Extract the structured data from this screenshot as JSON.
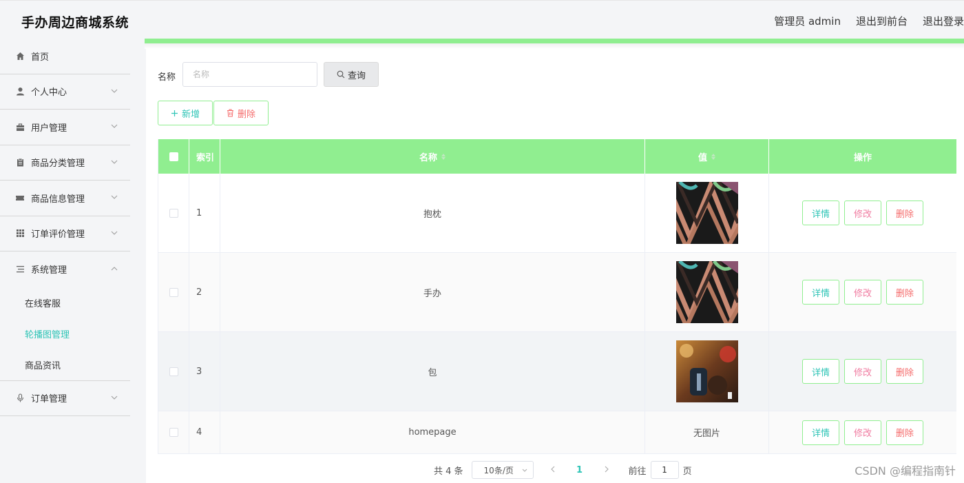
{
  "app": {
    "title": "手办周边商城系统"
  },
  "header": {
    "admin_label": "管理员 admin",
    "to_front": "退出到前台",
    "logout": "退出登录"
  },
  "sidebar": {
    "items": [
      {
        "label": "首页",
        "icon": "home-icon"
      },
      {
        "label": "个人中心",
        "icon": "user-icon"
      },
      {
        "label": "用户管理",
        "icon": "briefcase-icon"
      },
      {
        "label": "商品分类管理",
        "icon": "clipboard-icon"
      },
      {
        "label": "商品信息管理",
        "icon": "ticket-icon"
      },
      {
        "label": "订单评价管理",
        "icon": "grid-icon"
      },
      {
        "label": "系统管理",
        "icon": "list-icon"
      },
      {
        "label": "订单管理",
        "icon": "microphone-icon"
      }
    ],
    "system_sub": [
      {
        "label": "在线客服",
        "active": false
      },
      {
        "label": "轮播图管理",
        "active": true
      },
      {
        "label": "商品资讯",
        "active": false
      }
    ]
  },
  "search": {
    "label": "名称",
    "placeholder": "名称",
    "button": "查询"
  },
  "actions": {
    "add": "新增",
    "delete": "删除"
  },
  "table": {
    "columns": [
      "索引",
      "名称",
      "值",
      "操作"
    ],
    "rows": [
      {
        "index": "1",
        "name": "抱枕",
        "value": "",
        "image": "pattern"
      },
      {
        "index": "2",
        "name": "手办",
        "value": "",
        "image": "pattern"
      },
      {
        "index": "3",
        "name": "包",
        "value": "",
        "image": "photo"
      },
      {
        "index": "4",
        "name": "homepage",
        "value": "无图片",
        "image": "none"
      }
    ],
    "row_actions": {
      "detail": "详情",
      "edit": "修改",
      "delete": "删除"
    }
  },
  "pagination": {
    "total": "共 4 条",
    "page_size": "10条/页",
    "current": "1",
    "goto_label": "前往",
    "goto_value": "1",
    "page_suffix": "页"
  },
  "watermark": "CSDN @编程指南针",
  "colors": {
    "accent": "#90ee90",
    "teal": "#2ec4b6",
    "danger": "#f56c6c",
    "pink": "#f07ba0"
  }
}
